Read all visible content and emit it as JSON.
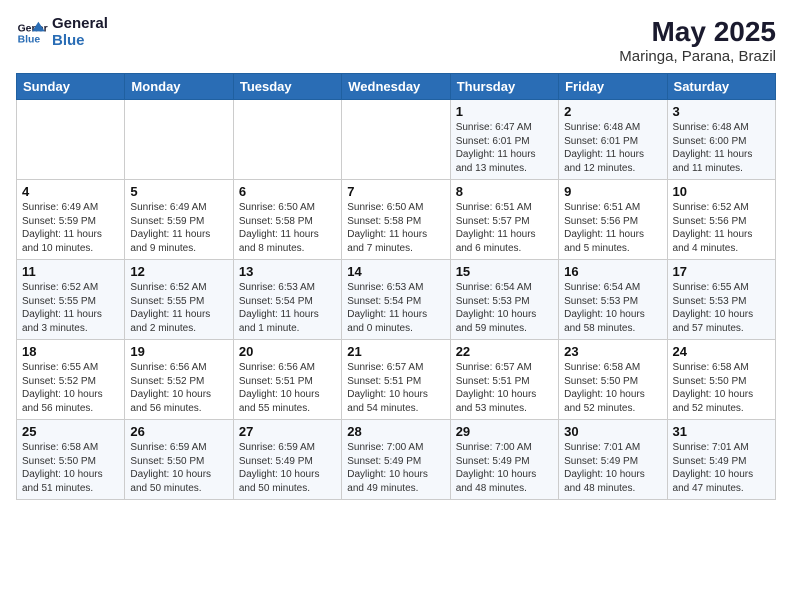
{
  "logo": {
    "line1": "General",
    "line2": "Blue"
  },
  "title": "May 2025",
  "location": "Maringa, Parana, Brazil",
  "days_of_week": [
    "Sunday",
    "Monday",
    "Tuesday",
    "Wednesday",
    "Thursday",
    "Friday",
    "Saturday"
  ],
  "weeks": [
    [
      {
        "day": "",
        "info": ""
      },
      {
        "day": "",
        "info": ""
      },
      {
        "day": "",
        "info": ""
      },
      {
        "day": "",
        "info": ""
      },
      {
        "day": "1",
        "info": "Sunrise: 6:47 AM\nSunset: 6:01 PM\nDaylight: 11 hours\nand 13 minutes."
      },
      {
        "day": "2",
        "info": "Sunrise: 6:48 AM\nSunset: 6:01 PM\nDaylight: 11 hours\nand 12 minutes."
      },
      {
        "day": "3",
        "info": "Sunrise: 6:48 AM\nSunset: 6:00 PM\nDaylight: 11 hours\nand 11 minutes."
      }
    ],
    [
      {
        "day": "4",
        "info": "Sunrise: 6:49 AM\nSunset: 5:59 PM\nDaylight: 11 hours\nand 10 minutes."
      },
      {
        "day": "5",
        "info": "Sunrise: 6:49 AM\nSunset: 5:59 PM\nDaylight: 11 hours\nand 9 minutes."
      },
      {
        "day": "6",
        "info": "Sunrise: 6:50 AM\nSunset: 5:58 PM\nDaylight: 11 hours\nand 8 minutes."
      },
      {
        "day": "7",
        "info": "Sunrise: 6:50 AM\nSunset: 5:58 PM\nDaylight: 11 hours\nand 7 minutes."
      },
      {
        "day": "8",
        "info": "Sunrise: 6:51 AM\nSunset: 5:57 PM\nDaylight: 11 hours\nand 6 minutes."
      },
      {
        "day": "9",
        "info": "Sunrise: 6:51 AM\nSunset: 5:56 PM\nDaylight: 11 hours\nand 5 minutes."
      },
      {
        "day": "10",
        "info": "Sunrise: 6:52 AM\nSunset: 5:56 PM\nDaylight: 11 hours\nand 4 minutes."
      }
    ],
    [
      {
        "day": "11",
        "info": "Sunrise: 6:52 AM\nSunset: 5:55 PM\nDaylight: 11 hours\nand 3 minutes."
      },
      {
        "day": "12",
        "info": "Sunrise: 6:52 AM\nSunset: 5:55 PM\nDaylight: 11 hours\nand 2 minutes."
      },
      {
        "day": "13",
        "info": "Sunrise: 6:53 AM\nSunset: 5:54 PM\nDaylight: 11 hours\nand 1 minute."
      },
      {
        "day": "14",
        "info": "Sunrise: 6:53 AM\nSunset: 5:54 PM\nDaylight: 11 hours\nand 0 minutes."
      },
      {
        "day": "15",
        "info": "Sunrise: 6:54 AM\nSunset: 5:53 PM\nDaylight: 10 hours\nand 59 minutes."
      },
      {
        "day": "16",
        "info": "Sunrise: 6:54 AM\nSunset: 5:53 PM\nDaylight: 10 hours\nand 58 minutes."
      },
      {
        "day": "17",
        "info": "Sunrise: 6:55 AM\nSunset: 5:53 PM\nDaylight: 10 hours\nand 57 minutes."
      }
    ],
    [
      {
        "day": "18",
        "info": "Sunrise: 6:55 AM\nSunset: 5:52 PM\nDaylight: 10 hours\nand 56 minutes."
      },
      {
        "day": "19",
        "info": "Sunrise: 6:56 AM\nSunset: 5:52 PM\nDaylight: 10 hours\nand 56 minutes."
      },
      {
        "day": "20",
        "info": "Sunrise: 6:56 AM\nSunset: 5:51 PM\nDaylight: 10 hours\nand 55 minutes."
      },
      {
        "day": "21",
        "info": "Sunrise: 6:57 AM\nSunset: 5:51 PM\nDaylight: 10 hours\nand 54 minutes."
      },
      {
        "day": "22",
        "info": "Sunrise: 6:57 AM\nSunset: 5:51 PM\nDaylight: 10 hours\nand 53 minutes."
      },
      {
        "day": "23",
        "info": "Sunrise: 6:58 AM\nSunset: 5:50 PM\nDaylight: 10 hours\nand 52 minutes."
      },
      {
        "day": "24",
        "info": "Sunrise: 6:58 AM\nSunset: 5:50 PM\nDaylight: 10 hours\nand 52 minutes."
      }
    ],
    [
      {
        "day": "25",
        "info": "Sunrise: 6:58 AM\nSunset: 5:50 PM\nDaylight: 10 hours\nand 51 minutes."
      },
      {
        "day": "26",
        "info": "Sunrise: 6:59 AM\nSunset: 5:50 PM\nDaylight: 10 hours\nand 50 minutes."
      },
      {
        "day": "27",
        "info": "Sunrise: 6:59 AM\nSunset: 5:49 PM\nDaylight: 10 hours\nand 50 minutes."
      },
      {
        "day": "28",
        "info": "Sunrise: 7:00 AM\nSunset: 5:49 PM\nDaylight: 10 hours\nand 49 minutes."
      },
      {
        "day": "29",
        "info": "Sunrise: 7:00 AM\nSunset: 5:49 PM\nDaylight: 10 hours\nand 48 minutes."
      },
      {
        "day": "30",
        "info": "Sunrise: 7:01 AM\nSunset: 5:49 PM\nDaylight: 10 hours\nand 48 minutes."
      },
      {
        "day": "31",
        "info": "Sunrise: 7:01 AM\nSunset: 5:49 PM\nDaylight: 10 hours\nand 47 minutes."
      }
    ]
  ]
}
